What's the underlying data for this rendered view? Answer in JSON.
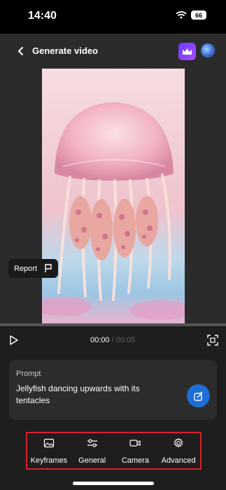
{
  "status_bar": {
    "time": "14:40",
    "battery": "66"
  },
  "header": {
    "title": "Generate video"
  },
  "video": {
    "report_label": "Report",
    "current_time": "00:00",
    "separator": "/",
    "duration": "00:05",
    "progress": 0
  },
  "prompt": {
    "label": "Prompt",
    "text": "Jellyfish dancing upwards with its tentacles"
  },
  "tabs": [
    {
      "label": "Keyframes",
      "icon": "image-icon"
    },
    {
      "label": "General",
      "icon": "sliders-icon"
    },
    {
      "label": "Camera",
      "icon": "video-camera-icon"
    },
    {
      "label": "Advanced",
      "icon": "gear-icon"
    }
  ],
  "colors": {
    "accent": "#1d6ed8",
    "highlight_border": "#d9202c",
    "premium": "#6b3cff"
  }
}
